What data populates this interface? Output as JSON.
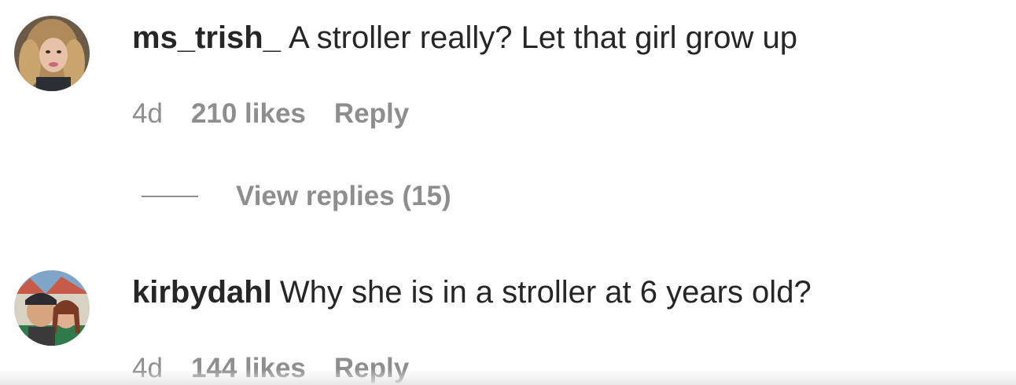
{
  "comments": [
    {
      "username": "ms_trish_",
      "text": "A stroller really? Let that girl grow up",
      "time": "4d",
      "likes": "210 likes",
      "reply": "Reply",
      "view_replies": "View replies (15)"
    },
    {
      "username": "kirbydahl",
      "text": "Why she is in a stroller at 6 years old?",
      "time": "4d",
      "likes": "144 likes",
      "reply": "Reply"
    }
  ],
  "colors": {
    "text": "#262626",
    "muted": "#8e8e8e",
    "background": "#ffffff"
  }
}
